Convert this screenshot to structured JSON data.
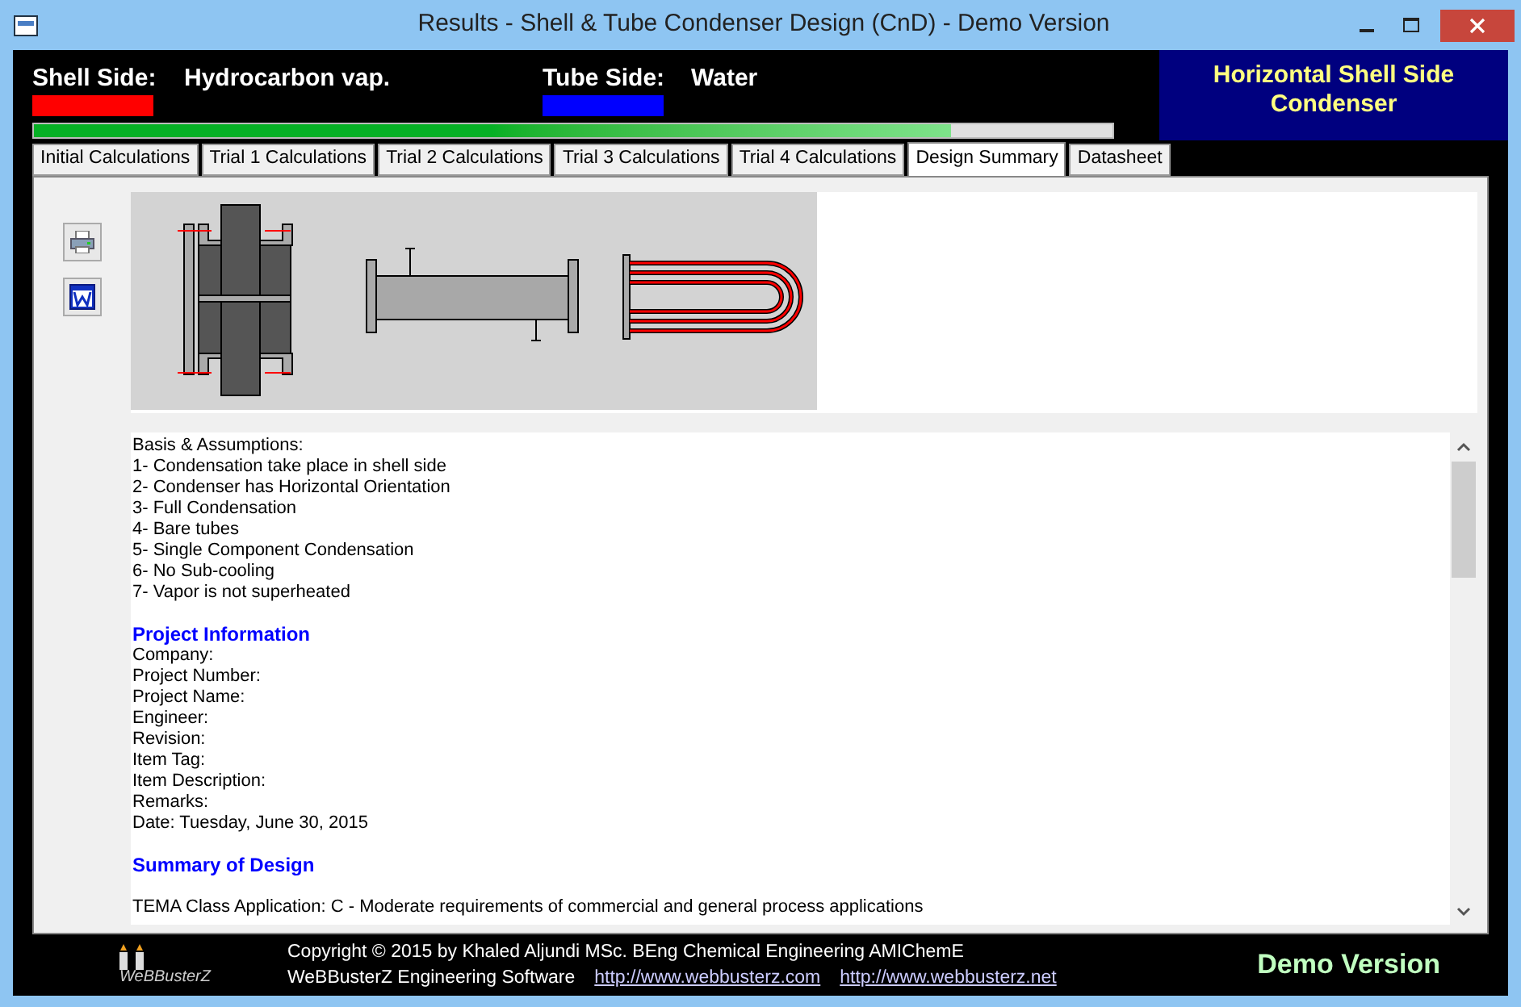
{
  "window": {
    "title": "Results - Shell & Tube Condenser Design (CnD) - Demo Version"
  },
  "header": {
    "sides": [
      {
        "label": "Shell Side:",
        "fluid": "Hydrocarbon vap.",
        "color": "#ff0000"
      },
      {
        "label": "Tube Side:",
        "fluid": "Water",
        "color": "#0000ff"
      }
    ],
    "type": "Horizontal Shell Side Condenser",
    "progress": {
      "level": 0.85
    }
  },
  "tabs": [
    {
      "label": "Initial Calculations",
      "selected": false
    },
    {
      "label": "Trial 1 Calculations",
      "selected": false
    },
    {
      "label": "Trial 2 Calculations",
      "selected": false
    },
    {
      "label": "Trial 3 Calculations",
      "selected": false
    },
    {
      "label": "Trial 4 Calculations",
      "selected": false
    },
    {
      "label": "Design Summary",
      "selected": true
    },
    {
      "label": "Datasheet",
      "selected": false
    }
  ],
  "report": {
    "lines": [
      {
        "kind": "text",
        "text": "Basis & Assumptions:"
      },
      {
        "kind": "text",
        "text": "1- Condensation take place in shell side"
      },
      {
        "kind": "text",
        "text": "2- Condenser has Horizontal Orientation"
      },
      {
        "kind": "text",
        "text": "3- Full Condensation"
      },
      {
        "kind": "text",
        "text": "4- Bare tubes"
      },
      {
        "kind": "text",
        "text": "5- Single Component Condensation"
      },
      {
        "kind": "text",
        "text": "6- No Sub-cooling"
      },
      {
        "kind": "text",
        "text": "7- Vapor is not superheated"
      },
      {
        "kind": "heading",
        "text": "Project Information"
      },
      {
        "kind": "text",
        "text": "Company:"
      },
      {
        "kind": "text",
        "text": "Project Number:"
      },
      {
        "kind": "text",
        "text": "Project Name:"
      },
      {
        "kind": "text",
        "text": "Engineer:"
      },
      {
        "kind": "text",
        "text": "Revision:"
      },
      {
        "kind": "text",
        "text": "Item Tag:"
      },
      {
        "kind": "text",
        "text": "Item Description:"
      },
      {
        "kind": "text",
        "text": "Remarks:"
      },
      {
        "kind": "text",
        "text": "Date: Tuesday, June 30, 2015"
      },
      {
        "kind": "heading",
        "text": "Summary of Design"
      },
      {
        "kind": "gap"
      },
      {
        "kind": "text",
        "text": "TEMA Class Application: C - Moderate requirements of commercial and general process applications"
      }
    ]
  },
  "footer": {
    "logo": "WeBBusterZ",
    "copyright": "Copyright © 2015 by Khaled Aljundi MSc. BEng Chemical Engineering AMIChemE",
    "company": "WeBBusterZ Engineering Software",
    "links": [
      "http://www.webbusterz.com",
      "http://www.webbusterz.net"
    ],
    "edition": "Demo Version"
  }
}
